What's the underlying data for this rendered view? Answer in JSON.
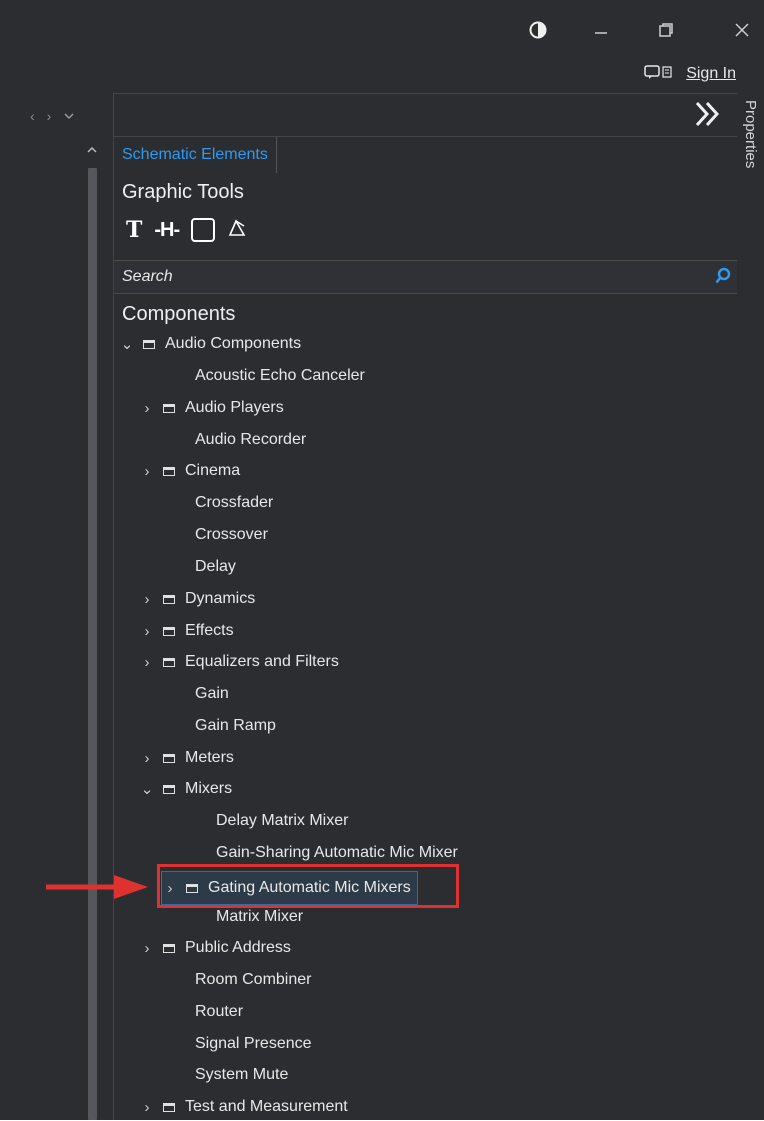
{
  "window": {
    "theme_icon": "contrast-icon",
    "minimize_icon": "minimize-icon",
    "restore_icon": "restore-icon",
    "close_icon": "close-icon",
    "sign_in": "Sign In"
  },
  "nav": {
    "back": "‹",
    "forward": "›",
    "menu": "⌄"
  },
  "panel": {
    "tab_label": "Schematic Elements",
    "graphic_tools_heading": "Graphic Tools",
    "tools": [
      "T",
      "-H-"
    ],
    "search_placeholder": "Search",
    "components_heading": "Components",
    "properties_label": "Properties"
  },
  "tree": {
    "audio_components": "Audio Components",
    "items": [
      {
        "label": "Acoustic Echo Canceler"
      },
      {
        "label": "Audio Players"
      },
      {
        "label": "Audio Recorder"
      },
      {
        "label": "Cinema"
      },
      {
        "label": "Crossfader"
      },
      {
        "label": "Crossover"
      },
      {
        "label": "Delay"
      },
      {
        "label": "Dynamics"
      },
      {
        "label": "Effects"
      },
      {
        "label": "Equalizers and Filters"
      },
      {
        "label": "Gain"
      },
      {
        "label": "Gain Ramp"
      },
      {
        "label": "Meters"
      },
      {
        "label": "Mixers"
      },
      {
        "label": "Public Address"
      },
      {
        "label": "Room Combiner"
      },
      {
        "label": "Router"
      },
      {
        "label": "Signal Presence"
      },
      {
        "label": "System Mute"
      },
      {
        "label": "Test and Measurement"
      }
    ],
    "mixers_children": [
      {
        "label": "Delay Matrix Mixer"
      },
      {
        "label": "Gain-Sharing Automatic Mic Mixer"
      },
      {
        "label": "Gating Automatic Mic Mixers"
      },
      {
        "label": "Matrix Mixer"
      }
    ]
  },
  "colors": {
    "accent": "#2e9bf0",
    "highlight_red": "#e03131",
    "background": "#2b2d31"
  }
}
